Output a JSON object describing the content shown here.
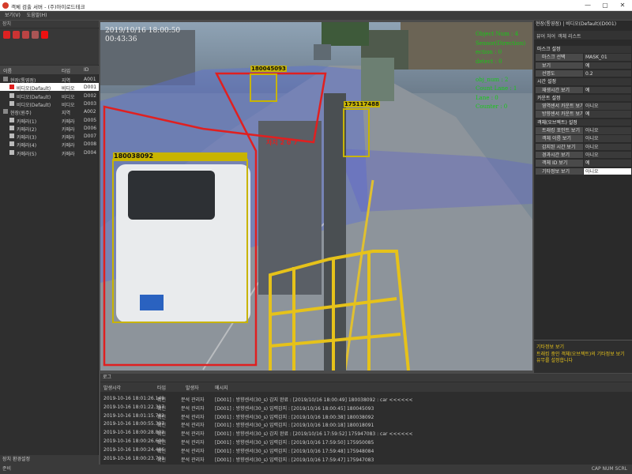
{
  "window": {
    "title": "객체 검출 서버 - (주)아이로드테크",
    "min": "—",
    "max": "▢",
    "close": "✕"
  },
  "menu": [
    "보기(V)",
    "도움말(H)"
  ],
  "left_panel": {
    "title": "장치",
    "columns": [
      "이름",
      "타입",
      "ID"
    ],
    "rows": [
      {
        "name": "현장(통영점)",
        "type": "지역",
        "id": "A001",
        "indent": 0,
        "icon": "folder-icon",
        "sel": false
      },
      {
        "name": "비디오(Default)",
        "type": "비디오",
        "id": "D001",
        "indent": 1,
        "icon": "video-red-icon",
        "sel": true
      },
      {
        "name": "비디오(Default)",
        "type": "비디오",
        "id": "D002",
        "indent": 1,
        "icon": "video-icon",
        "sel": false
      },
      {
        "name": "비디오(Default)",
        "type": "비디오",
        "id": "D003",
        "indent": 1,
        "icon": "video-icon",
        "sel": false
      },
      {
        "name": "현장(원주)",
        "type": "지역",
        "id": "A002",
        "indent": 0,
        "icon": "folder-icon",
        "sel": false
      },
      {
        "name": "카메라(1)",
        "type": "카메라",
        "id": "D005",
        "indent": 1,
        "icon": "camera-icon",
        "sel": false
      },
      {
        "name": "카메라(2)",
        "type": "카메라",
        "id": "D006",
        "indent": 1,
        "icon": "camera-icon",
        "sel": false
      },
      {
        "name": "카메라(3)",
        "type": "카메라",
        "id": "D007",
        "indent": 1,
        "icon": "camera-icon",
        "sel": false
      },
      {
        "name": "카메라(4)",
        "type": "카메라",
        "id": "D008",
        "indent": 1,
        "icon": "camera-icon",
        "sel": false
      },
      {
        "name": "카메라(5)",
        "type": "카메라",
        "id": "D004",
        "indent": 1,
        "icon": "camera-icon",
        "sel": false
      }
    ],
    "footer": "장치  환경설정"
  },
  "video": {
    "datetime": "2019/10/16 18:00:50",
    "elapsed": "00:43:36",
    "stats": [
      "Object Num : 4",
      "Sensor(Direction)",
      "ection : 0",
      "detect : 0",
      "",
      "obj_num : 2",
      "Count Lane : 1",
      "Lane : 0",
      "Counter : 0"
    ],
    "plate_text": "차지 2 0 7",
    "boxes": [
      {
        "id": "180038092",
        "color": "#c8b400"
      },
      {
        "id": "180045093",
        "color": "#c8b400"
      },
      {
        "id": "175117488",
        "color": "#c8b400"
      }
    ]
  },
  "right_panel": {
    "title": "현장(통영점) | 비디오(Default)(D001)",
    "tabs": [
      "뷰어 처어",
      "객체 리스트"
    ],
    "rows": [
      {
        "k": "마스크 설정",
        "v": "",
        "sec": true
      },
      {
        "k": "마스크 선택",
        "v": "MASK_01"
      },
      {
        "k": "보기",
        "v": "예"
      },
      {
        "k": "선명도",
        "v": "0.2"
      },
      {
        "k": "시간 설정",
        "v": "",
        "sec": true
      },
      {
        "k": "재생시간 보기",
        "v": "예"
      },
      {
        "k": "카운트 설정",
        "v": "",
        "sec": true
      },
      {
        "k": "영역센서 카운트 보기",
        "v": "아니오"
      },
      {
        "k": "방향센서 카운트 보기",
        "v": "예"
      },
      {
        "k": "객체(오브젝트) 설정",
        "v": "",
        "sec": true
      },
      {
        "k": "트래킹 포인트 보기",
        "v": "아니오"
      },
      {
        "k": "객체 이름 보기",
        "v": "아니오"
      },
      {
        "k": "감지된 시간 보기",
        "v": "아니오"
      },
      {
        "k": "경과시간 보기",
        "v": "아니오"
      },
      {
        "k": "객체 ID 보기",
        "v": "예"
      },
      {
        "k": "기타정보 보기",
        "v": "아니오",
        "sel": true
      }
    ],
    "desc_title": "기타정보 보기",
    "desc_text": "트래킹 중인 객체(오브젝트)의 기타정보 보기 유무를 설정합니다"
  },
  "log": {
    "title": "로그",
    "columns": [
      "발생시각",
      "타입",
      "발생자",
      "메시지"
    ],
    "rows": [
      {
        "t": "2019-10-16 18:01:26.149",
        "type": "확인",
        "who": "분석 관리자",
        "msg": "[D001] : 방향센서(30_s) 감지 완료 : [2019/10/16 18:00:49] 180038092 : car <<<<<<"
      },
      {
        "t": "2019-10-16 18:01:22.317",
        "type": "확인",
        "who": "분석 관리자",
        "msg": "[D001] : 방향센서(30_s) 입력감지 : [2019/10/16 18:00:45] 180045093"
      },
      {
        "t": "2019-10-16 18:01:15.782",
        "type": "확인",
        "who": "분석 관리자",
        "msg": "[D001] : 방향센서(30_s) 입력감지 : [2019/10/16 18:00:38] 180038092"
      },
      {
        "t": "2019-10-16 18:00:55.397",
        "type": "확인",
        "who": "분석 관리자",
        "msg": "[D001] : 방향센서(30_s) 입력감지 : [2019/10/16 18:00:18] 180018091"
      },
      {
        "t": "2019-10-16 18:00:28.802",
        "type": "확인",
        "who": "분석 관리자",
        "msg": "[D001] : 방향센서(30_s) 감지 완료 : [2019/10/16 17:59:52] 175947083 : car <<<<<<"
      },
      {
        "t": "2019-10-16 18:00:26.600",
        "type": "확인",
        "who": "분석 관리자",
        "msg": "[D001] : 방향센서(30_s) 입력감지 : [2019/10/16 17:59:50] 175950085"
      },
      {
        "t": "2019-10-16 18:00:24.486",
        "type": "확인",
        "who": "분석 관리자",
        "msg": "[D001] : 방향센서(30_s) 입력감지 : [2019/10/16 17:59:48] 175948084"
      },
      {
        "t": "2019-10-16 18:00:23.791",
        "type": "확인",
        "who": "분석 관리자",
        "msg": "[D001] : 방향센서(30_s) 입력감지 : [2019/10/16 17:59:47] 175947083"
      }
    ]
  },
  "status": {
    "left": "준비",
    "right": "CAP  NUM  SCRL"
  }
}
